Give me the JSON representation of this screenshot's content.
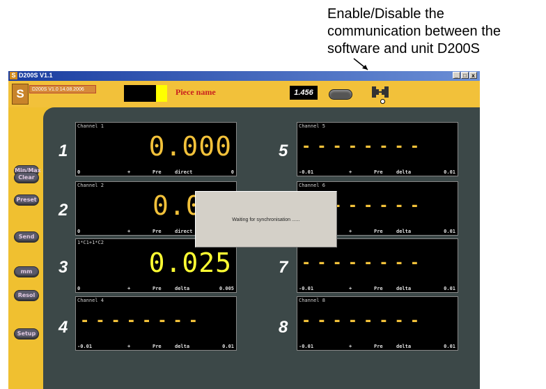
{
  "annotation": {
    "lines": [
      "Enable/Disable the",
      "communication between the",
      "software and unit D200S"
    ]
  },
  "window": {
    "title": "D200S V1.1",
    "controls": [
      "_",
      "□",
      "x"
    ]
  },
  "toolbar": {
    "logo_glyph": "S",
    "version": "D200S V1.0 14.08.2006",
    "piece_name": "Piece name",
    "value": "1.456",
    "comm_icon": "connect-plug-icon"
  },
  "sidebar": [
    {
      "label": "Min/Max"
    },
    {
      "label": "Clear"
    },
    {
      "label": "Preset"
    },
    {
      "label": "Send"
    },
    {
      "label": "mm"
    },
    {
      "label": "Resol"
    },
    {
      "label": "Setup"
    }
  ],
  "channels": [
    {
      "num": "1",
      "label": "Channel 1",
      "value": "0.000",
      "f1": "0",
      "f2": "+",
      "f3": "Pre",
      "f4": "direct",
      "f5": "0"
    },
    {
      "num": "2",
      "label": "Channel 2",
      "value": "0.0",
      "f1": "0",
      "f2": "+",
      "f3": "Pre",
      "f4": "direct",
      "f5": ""
    },
    {
      "num": "3",
      "label": "1*C1+1*C2",
      "value": "0.025",
      "f1": "0",
      "f2": "+",
      "f3": "Pre",
      "f4": "delta",
      "f5": "0.005"
    },
    {
      "num": "4",
      "label": "Channel 4",
      "value": "",
      "f1": "-0.01",
      "f2": "+",
      "f3": "Pre",
      "f4": "delta",
      "f5": "0.01"
    },
    {
      "num": "5",
      "label": "Channel 5",
      "value": "",
      "f1": "-0.01",
      "f2": "+",
      "f3": "Pre",
      "f4": "delta",
      "f5": "0.01"
    },
    {
      "num": "6",
      "label": "Channel 6",
      "value": "",
      "f1": "",
      "f2": "+",
      "f3": "Pre",
      "f4": "delta",
      "f5": "0.01"
    },
    {
      "num": "7",
      "label": "",
      "value": "",
      "f1": "-0.01",
      "f2": "+",
      "f3": "Pre",
      "f4": "delta",
      "f5": "0.01"
    },
    {
      "num": "8",
      "label": "Channel 8",
      "value": "",
      "f1": "-0.01",
      "f2": "+",
      "f3": "Pre",
      "f4": "delta",
      "f5": "0.01"
    }
  ],
  "dashes": "--------",
  "dialog": {
    "message": "Waiting for synchronisation ......"
  },
  "colors": {
    "accent": "#f2c13a",
    "panel": "#3c4848",
    "title_red": "#c81e1e"
  }
}
